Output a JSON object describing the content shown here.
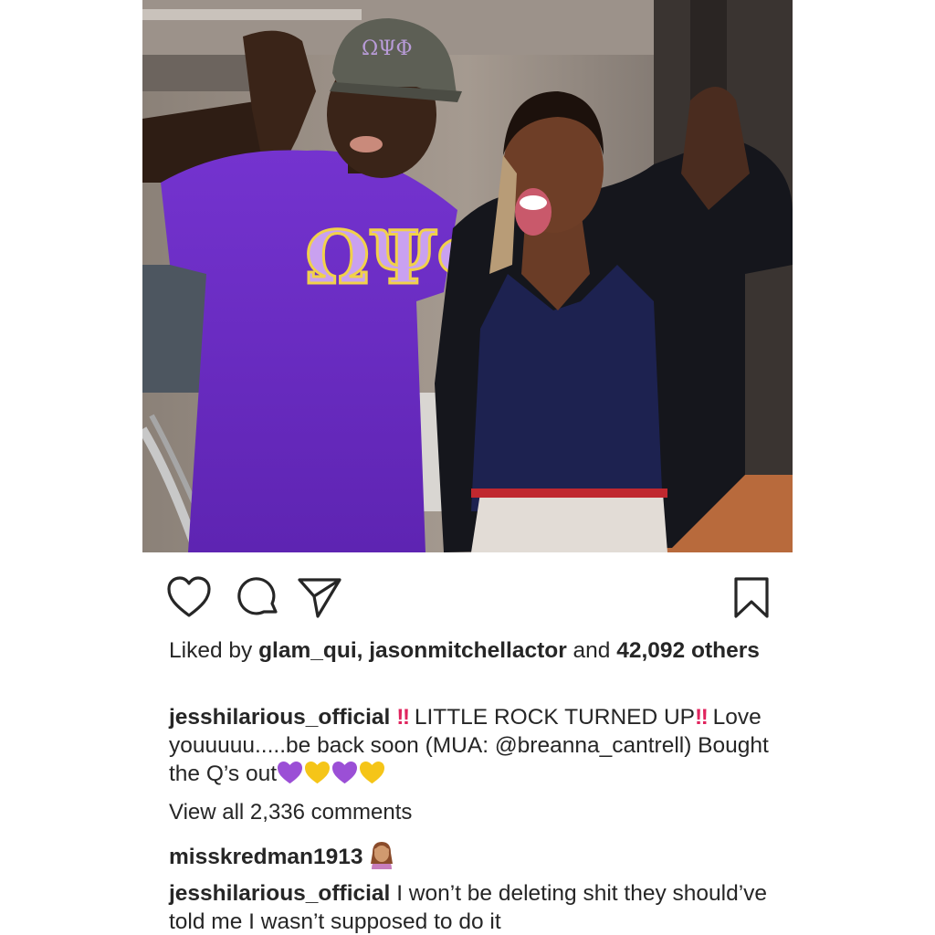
{
  "post": {
    "likes_prefix": "Liked by",
    "liker_1": "glam_qui",
    "liker_sep": ",",
    "liker_2": "jasonmitchellactor",
    "likes_and": "and",
    "likes_count": "42,092",
    "likes_others": "others",
    "caption": {
      "username": "jesshilarious_official",
      "bang": "‼",
      "text_1": "LITTLE ROCK TURNED UP",
      "text_2": "Love youuuuu.....be back soon (MUA:",
      "mention": "@breanna_cantrell",
      "text_3": ") Bought the Q’s out"
    },
    "view_all": "View all 2,336 comments",
    "comments": [
      {
        "username": "misskredman1913",
        "text": ""
      },
      {
        "username": "jesshilarious_official",
        "text": "I won’t be deleting shit they should’ve told me I wasn’t supposed to do it"
      }
    ],
    "photo_text": {
      "shirt_letters": "ΩΨΦ",
      "hat_letters": "ΩΨΦ"
    }
  },
  "icons": {
    "like": "heart-outline-icon",
    "comment": "speech-bubble-icon",
    "share": "paper-plane-icon",
    "save": "bookmark-icon",
    "emoji_purple": "purple-heart-emoji",
    "emoji_yellow": "yellow-heart-emoji",
    "emoji_woman": "woman-facepalming-emoji"
  },
  "colors": {
    "text": "#262626",
    "muted": "#999999",
    "mention": "#003569",
    "bang": "#e0245e",
    "purple_heart": "#9b4fd6",
    "yellow_heart": "#f5c518",
    "shirt_purple": "#6a2bc4"
  }
}
